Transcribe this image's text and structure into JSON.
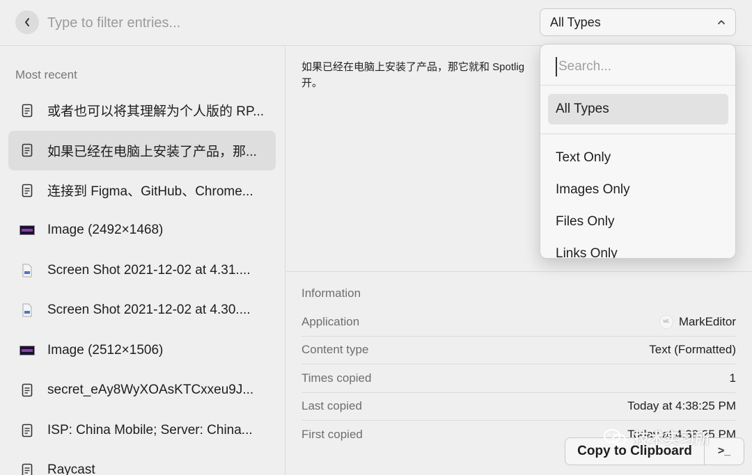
{
  "topbar": {
    "filter_placeholder": "Type to filter entries...",
    "type_select_value": "All Types"
  },
  "sidebar": {
    "section_title": "Most recent",
    "items": [
      {
        "label": "或者也可以将其理解为个人版的 RP...",
        "icon": "document-icon"
      },
      {
        "label": "如果已经在电脑上安装了产品，那...",
        "icon": "document-icon",
        "selected": true
      },
      {
        "label": "连接到 Figma、GitHub、Chrome...",
        "icon": "document-icon"
      },
      {
        "label": "Image (2492×1468)",
        "icon": "image-thumbnail-icon"
      },
      {
        "label": "Screen Shot 2021-12-02 at 4.31....",
        "icon": "file-icon"
      },
      {
        "label": "Screen Shot 2021-12-02 at 4.30....",
        "icon": "file-icon"
      },
      {
        "label": "Image (2512×1506)",
        "icon": "image-thumbnail-icon"
      },
      {
        "label": "secret_eAy8WyXOAsKTCxxeu9J...",
        "icon": "document-icon"
      },
      {
        "label": "ISP: China Mobile; Server: China...",
        "icon": "document-icon"
      },
      {
        "label": "Raycast",
        "icon": "document-icon"
      }
    ]
  },
  "detail": {
    "preview_line1": "如果已经在电脑上安装了产品，那它就和 Spotlig",
    "preview_line2": "开。",
    "info_title": "Information",
    "rows": [
      {
        "key": "Application",
        "value": "MarkEditor",
        "badge": "ME"
      },
      {
        "key": "Content type",
        "value": "Text (Formatted)"
      },
      {
        "key": "Times copied",
        "value": "1"
      },
      {
        "key": "Last copied",
        "value": "Today at 4:38:25 PM"
      },
      {
        "key": "First copied",
        "value": "Today at 4:38:25 PM"
      }
    ]
  },
  "actions": {
    "copy_label": "Copy to Clipboard",
    "more_label": ">_"
  },
  "dropdown": {
    "search_placeholder": "Search...",
    "options": [
      "All Types",
      "Text Only",
      "Images Only",
      "Files Only",
      "Links Only"
    ],
    "selected": "All Types"
  },
  "watermark": {
    "text": "技术实习所"
  }
}
